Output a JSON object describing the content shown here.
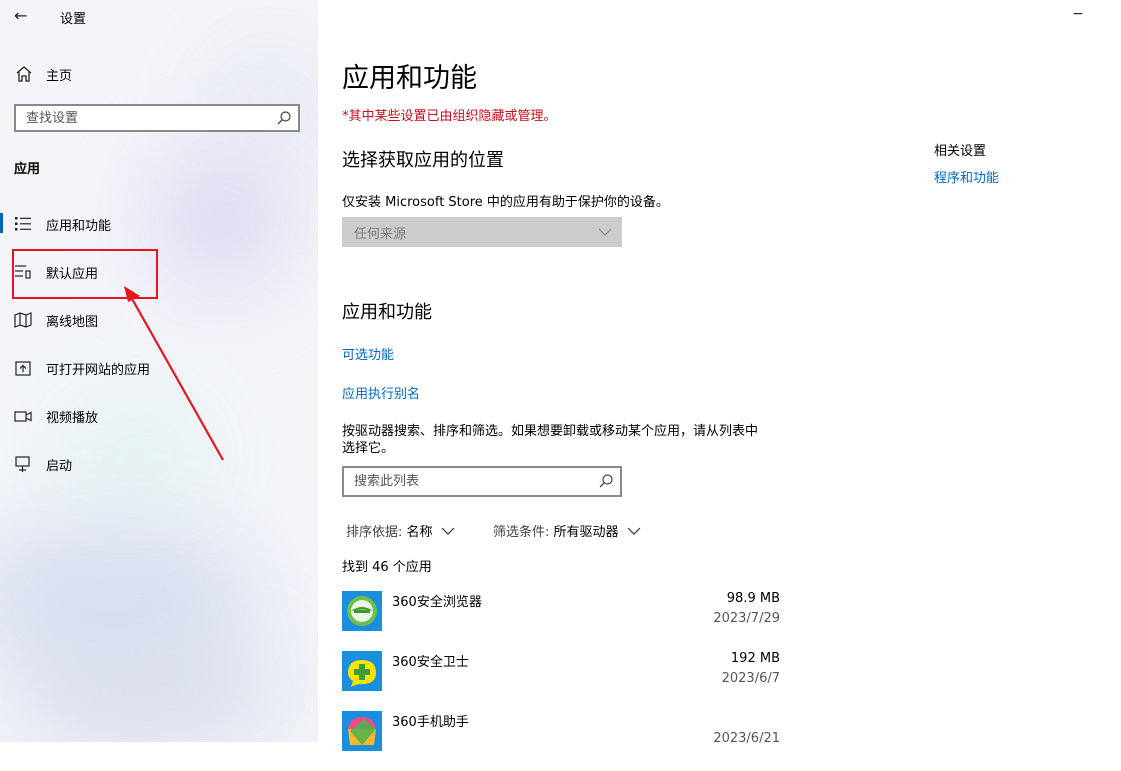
{
  "window": {
    "title": "设置",
    "back_icon": "←",
    "minimize_icon": "−"
  },
  "sidebar": {
    "home_label": "主页",
    "search_placeholder": "查找设置",
    "section_title": "应用",
    "items": [
      {
        "label": "应用和功能",
        "icon": "apps-features-icon",
        "active": true
      },
      {
        "label": "默认应用",
        "icon": "default-apps-icon",
        "active": false
      },
      {
        "label": "离线地图",
        "icon": "offline-maps-icon",
        "active": false
      },
      {
        "label": "可打开网站的应用",
        "icon": "apps-for-websites-icon",
        "active": false
      },
      {
        "label": "视频播放",
        "icon": "video-playback-icon",
        "active": false
      },
      {
        "label": "启动",
        "icon": "startup-icon",
        "active": false
      }
    ],
    "annotation_color": "#e8141f"
  },
  "main": {
    "title": "应用和功能",
    "warning": "*其中某些设置已由组织隐藏或管理。",
    "choose_section": {
      "heading": "选择获取应用的位置",
      "description": "仅安装 Microsoft Store 中的应用有助于保护你的设备。",
      "dropdown_value": "任何来源"
    },
    "apps_section": {
      "heading": "应用和功能",
      "link_optional": "可选功能",
      "link_alias": "应用执行别名",
      "instructions_line1": "按驱动器搜索、排序和筛选。如果想要卸载或移动某个应用，请从列表中",
      "instructions_line2": "选择它。",
      "search_placeholder": "搜索此列表",
      "sort_label": "排序依据:",
      "sort_value": "名称",
      "filter_label": "筛选条件:",
      "filter_value": "所有驱动器",
      "found_text": "找到 46 个应用",
      "apps": [
        {
          "name": "360安全浏览器",
          "size": "98.9 MB",
          "date": "2023/7/29"
        },
        {
          "name": "360安全卫士",
          "size": "192 MB",
          "date": "2023/6/7"
        },
        {
          "name": "360手机助手",
          "size": "",
          "date": "2023/6/21"
        }
      ]
    }
  },
  "related": {
    "title": "相关设置",
    "link": "程序和功能"
  },
  "colors": {
    "accent": "#0067c0",
    "warning": "#c50f1f"
  }
}
